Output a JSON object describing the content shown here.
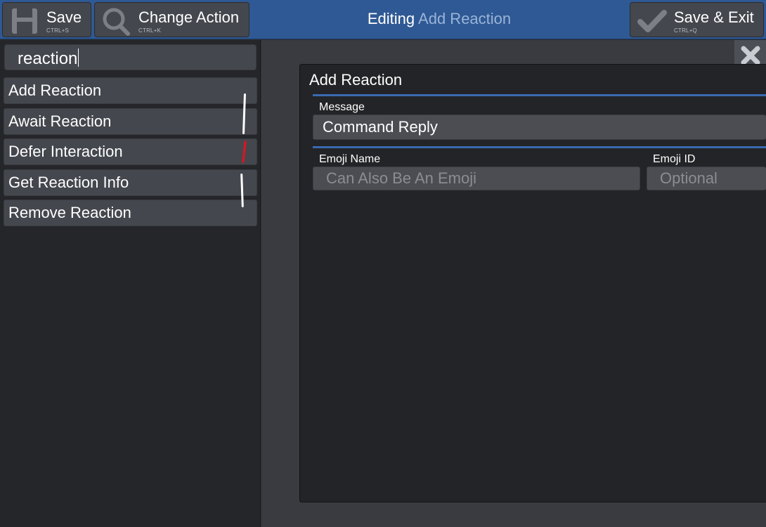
{
  "toolbar": {
    "save": {
      "label": "Save",
      "shortcut": "CTRL+S",
      "icon": "floppy-disk-icon"
    },
    "change_action": {
      "label": "Change Action",
      "shortcut": "CTRL+K",
      "icon": "search-icon"
    },
    "save_exit": {
      "label": "Save & Exit",
      "shortcut": "CTRL+Q",
      "icon": "checkmark-icon"
    }
  },
  "header": {
    "prefix": "Editing",
    "action_name": "Add Reaction"
  },
  "sidebar": {
    "search_value": "reaction",
    "items": [
      {
        "label": "Add Reaction"
      },
      {
        "label": "Await Reaction"
      },
      {
        "label": "Defer Interaction"
      },
      {
        "label": "Get Reaction Info"
      },
      {
        "label": "Remove Reaction"
      }
    ]
  },
  "panel": {
    "title": "Add Reaction",
    "message_label": "Message",
    "message_value": "Command Reply",
    "emoji_name_label": "Emoji Name",
    "emoji_name_placeholder": "Can Also Be An Emoji",
    "emoji_id_label": "Emoji ID",
    "emoji_id_placeholder": "Optional"
  },
  "colors": {
    "topbar": "#2f5994",
    "accent_line": "#3a6ab0",
    "button": "#44474d",
    "panel_bg": "#232427",
    "annotation_white": "#ffffff",
    "annotation_red": "#e0141e"
  }
}
